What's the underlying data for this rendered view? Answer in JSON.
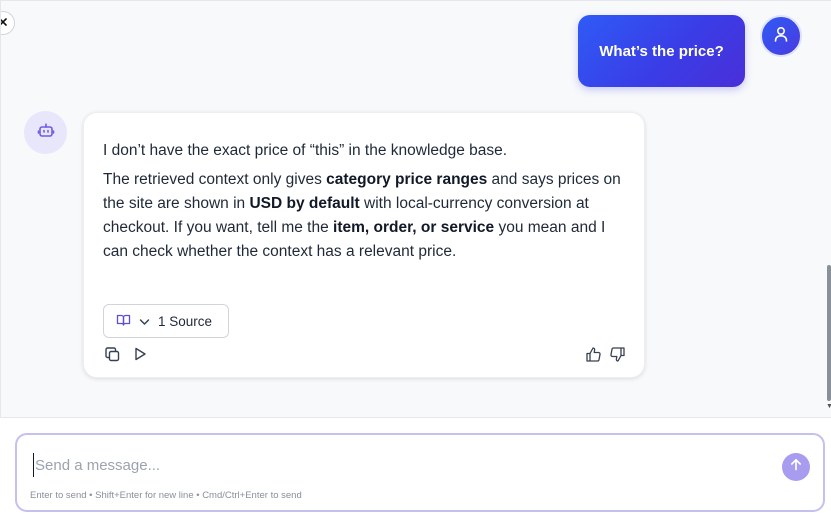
{
  "conversation": {
    "user_message": "What’s the price?",
    "bot_message": {
      "paragraph1": "I don’t have the exact price of “this” in the knowledge base.",
      "paragraph2_parts": {
        "t1": "The retrieved context only gives ",
        "b1": "category price ranges",
        "t2": " and says prices on the site are shown in ",
        "b2": "USD by default",
        "t3": " with local-currency conversion at checkout. If you want, tell me the ",
        "b3": "item, order, or service",
        "t4": " you mean and I can check whether the context has a relevant price."
      },
      "sources_label": "1 Source"
    }
  },
  "composer": {
    "placeholder": "Send a message...",
    "value": "",
    "hint": "Enter to send • Shift+Enter for new line • Cmd/Ctrl+Enter to send"
  },
  "icons": {
    "close": "close-icon",
    "user_avatar": "user-icon",
    "bot_avatar": "bot-icon",
    "sources": "book-icon",
    "chevron": "chevron-down-icon",
    "copy": "copy-icon",
    "play": "play-icon",
    "thumbs_up": "thumbs-up-icon",
    "thumbs_down": "thumbs-down-icon",
    "send": "arrow-up-icon"
  },
  "colors": {
    "accent": "#3a3de6",
    "send_button": "#a79cf0",
    "input_border": "#c4c0ef",
    "bot_avatar_bg": "#e8e6fb"
  }
}
